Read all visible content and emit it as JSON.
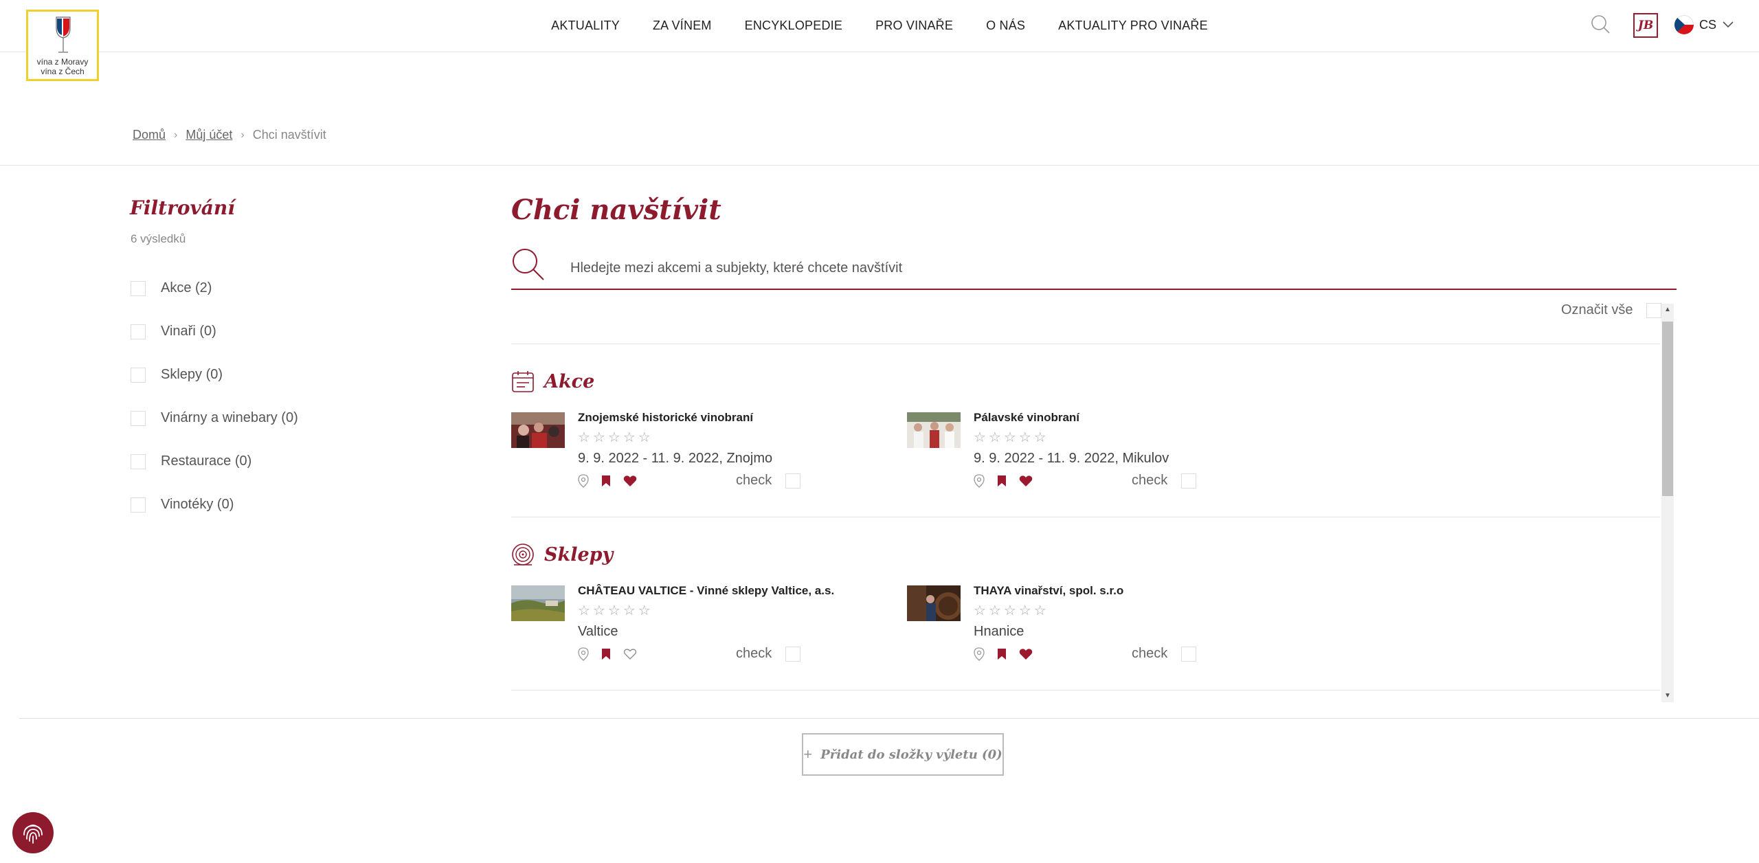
{
  "header": {
    "logo_text_line1": "vína z Moravy",
    "logo_text_line2": "vína z Čech",
    "nav": [
      "AKTUALITY",
      "ZA VÍNEM",
      "ENCYKLOPEDIE",
      "PRO VINAŘE",
      "O NÁS",
      "AKTUALITY PRO VINAŘE"
    ],
    "user_initials": "JB",
    "language": "CS"
  },
  "breadcrumb": {
    "items": [
      "Domů",
      "Můj účet"
    ],
    "current": "Chci navštívit"
  },
  "sidebar": {
    "title": "Filtrování",
    "results": "6 výsledků",
    "filters": [
      {
        "label": "Akce (2)"
      },
      {
        "label": "Vinaři (0)"
      },
      {
        "label": "Sklepy (0)"
      },
      {
        "label": "Vinárny a winebary (0)"
      },
      {
        "label": "Restaurace (0)"
      },
      {
        "label": "Vinotéky (0)"
      }
    ]
  },
  "main": {
    "title": "Chci navštívit",
    "search_placeholder": "Hledejte mezi akcemi a subjekty, které chcete navštívit",
    "select_all_label": "Označit vše",
    "sections": [
      {
        "title": "Akce",
        "icon": "calendar-icon",
        "items": [
          {
            "name": "Znojemské historické vinobraní",
            "stars": "☆☆☆☆☆",
            "meta": "9. 9. 2022 - 11. 9. 2022, Znojmo",
            "check_label": "check",
            "favorite": true
          },
          {
            "name": "Pálavské vinobraní",
            "stars": "☆☆☆☆☆",
            "meta": "9. 9. 2022 - 11. 9. 2022, Mikulov",
            "check_label": "check",
            "favorite": true
          }
        ]
      },
      {
        "title": "Sklepy",
        "icon": "barrel-icon",
        "items": [
          {
            "name": "CHÂTEAU VALTICE - Vinné sklepy Valtice, a.s.",
            "stars": "☆☆☆☆☆",
            "meta": "Valtice",
            "check_label": "check",
            "favorite": false
          },
          {
            "name": "THAYA vinařství, spol. s.r.o",
            "stars": "☆☆☆☆☆",
            "meta": "Hnanice",
            "check_label": "check",
            "favorite": true
          }
        ]
      }
    ],
    "add_button_label": "Přidat do složky výletu (0)",
    "add_button_plus": "+"
  },
  "colors": {
    "accent": "#8e1a2e",
    "logo_border": "#f1cf2c"
  }
}
